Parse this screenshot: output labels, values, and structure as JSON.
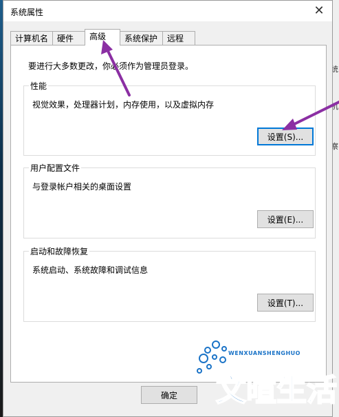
{
  "window": {
    "title": "系统属性",
    "close_glyph": "✕"
  },
  "tabs": [
    {
      "label": "计算机名",
      "active": false
    },
    {
      "label": "硬件",
      "active": false
    },
    {
      "label": "高级",
      "active": true
    },
    {
      "label": "系统保护",
      "active": false
    },
    {
      "label": "远程",
      "active": false
    }
  ],
  "panel": {
    "notice": "要进行大多数更改，你必须作为管理员登录。",
    "groups": [
      {
        "title": "性能",
        "description": "视觉效果，处理器计划，内存使用，以及虚拟内存",
        "button": "设置(S)..."
      },
      {
        "title": "用户配置文件",
        "description": "与登录帐户相关的桌面设置",
        "button": "设置(E)..."
      },
      {
        "title": "启动和故障恢复",
        "description": "系统启动、系统故障和调试信息",
        "button": "设置(T)..."
      }
    ]
  },
  "footer": {
    "ok_label": "确定"
  },
  "watermark": {
    "subtitle": "WENXUANSHENGHUO",
    "title": "文暄生活"
  },
  "background_text": {
    "right_1": "统",
    "right_2": "机",
    "right_3": "察"
  },
  "colors": {
    "annotation_arrow": "#8b2fa3",
    "focus_border": "#0078d7",
    "watermark_blue": "#1a73c7"
  }
}
